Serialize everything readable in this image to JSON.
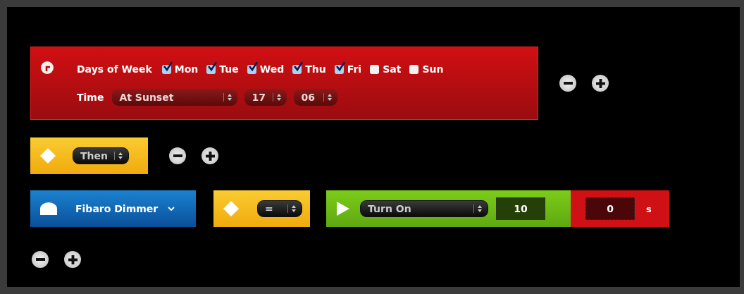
{
  "condition": {
    "days_label": "Days of Week",
    "days": [
      {
        "label": "Mon",
        "checked": true
      },
      {
        "label": "Tue",
        "checked": true
      },
      {
        "label": "Wed",
        "checked": true
      },
      {
        "label": "Thu",
        "checked": true
      },
      {
        "label": "Fri",
        "checked": true
      },
      {
        "label": "Sat",
        "checked": false
      },
      {
        "label": "Sun",
        "checked": false
      }
    ],
    "time_label": "Time",
    "time_selects": [
      "At Sunset",
      "17",
      "06"
    ]
  },
  "then_select": "Then",
  "action": {
    "device": "Fibaro Dimmer",
    "operator": "=",
    "command": "Turn On",
    "value": "10",
    "delay": "0",
    "delay_unit": "s"
  }
}
